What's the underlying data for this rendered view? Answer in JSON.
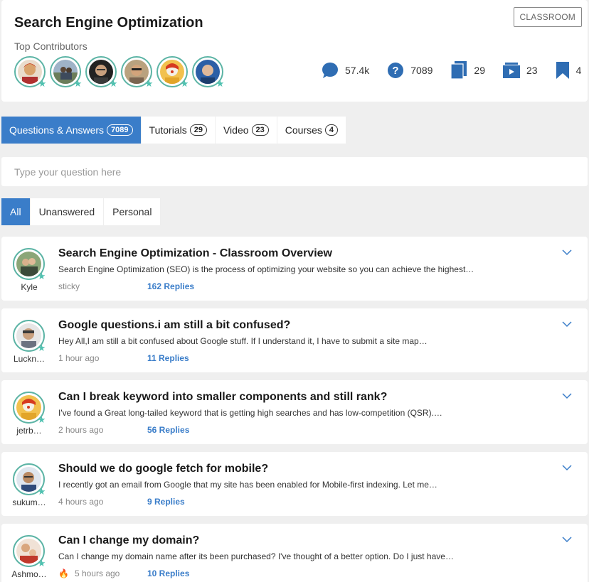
{
  "header": {
    "title": "Search Engine Optimization",
    "classroom_label": "CLASSROOM",
    "contributors_label": "Top Contributors",
    "contributors": [
      {
        "name": "contributor-1"
      },
      {
        "name": "contributor-2"
      },
      {
        "name": "contributor-3"
      },
      {
        "name": "contributor-4"
      },
      {
        "name": "contributor-5"
      },
      {
        "name": "contributor-6"
      }
    ],
    "stats": [
      {
        "icon": "comment-icon",
        "value": "57.4k"
      },
      {
        "icon": "question-icon",
        "value": "7089"
      },
      {
        "icon": "tutorials-icon",
        "value": "29"
      },
      {
        "icon": "video-icon",
        "value": "23"
      },
      {
        "icon": "bookmark-icon",
        "value": "4"
      }
    ]
  },
  "tabs": [
    {
      "label": "Questions & Answers",
      "count": "7089"
    },
    {
      "label": "Tutorials",
      "count": "29"
    },
    {
      "label": "Video",
      "count": "23"
    },
    {
      "label": "Courses",
      "count": "4"
    }
  ],
  "ask": {
    "placeholder": "Type your question here"
  },
  "filters": [
    {
      "label": "All"
    },
    {
      "label": "Unanswered"
    },
    {
      "label": "Personal"
    }
  ],
  "questions": [
    {
      "user": "Kyle",
      "title": "Search Engine Optimization - Classroom Overview",
      "excerpt": "Search Engine Optimization (SEO) is the process of optimizing your website so you can achieve the highest…",
      "meta": "sticky",
      "replies": "162 Replies"
    },
    {
      "user": "Luckn…",
      "title": "Google questions.i am still a bit confused?",
      "excerpt": "Hey All,I am still a bit confused about Google stuff. If I understand it, I have to submit a site map…",
      "meta": "1 hour ago",
      "replies": "11 Replies"
    },
    {
      "user": "jetrb…",
      "title": "Can I break keyword into smaller components and still rank?",
      "excerpt": "I've found a Great long-tailed keyword that is getting high searches and has low-competition (QSR).…",
      "meta": "2 hours ago",
      "replies": "56 Replies"
    },
    {
      "user": "sukum…",
      "title": "Should we do google fetch for mobile?",
      "excerpt": "I recently got an email from Google that my site has been enabled for Mobile-first indexing. Let me…",
      "meta": "4 hours ago",
      "replies": "9 Replies"
    },
    {
      "user": "Ashmo…",
      "title": "Can I change my domain?",
      "excerpt": "Can I change my domain name after its been purchased? I've thought of a better option. Do I just have…",
      "meta": "5 hours ago",
      "replies": "10 Replies"
    }
  ],
  "colors": {
    "accent": "#3a7dc9",
    "avatar_ring": "#5cb4a5",
    "star": "#4fc1b0",
    "fire": "#e8772e"
  }
}
